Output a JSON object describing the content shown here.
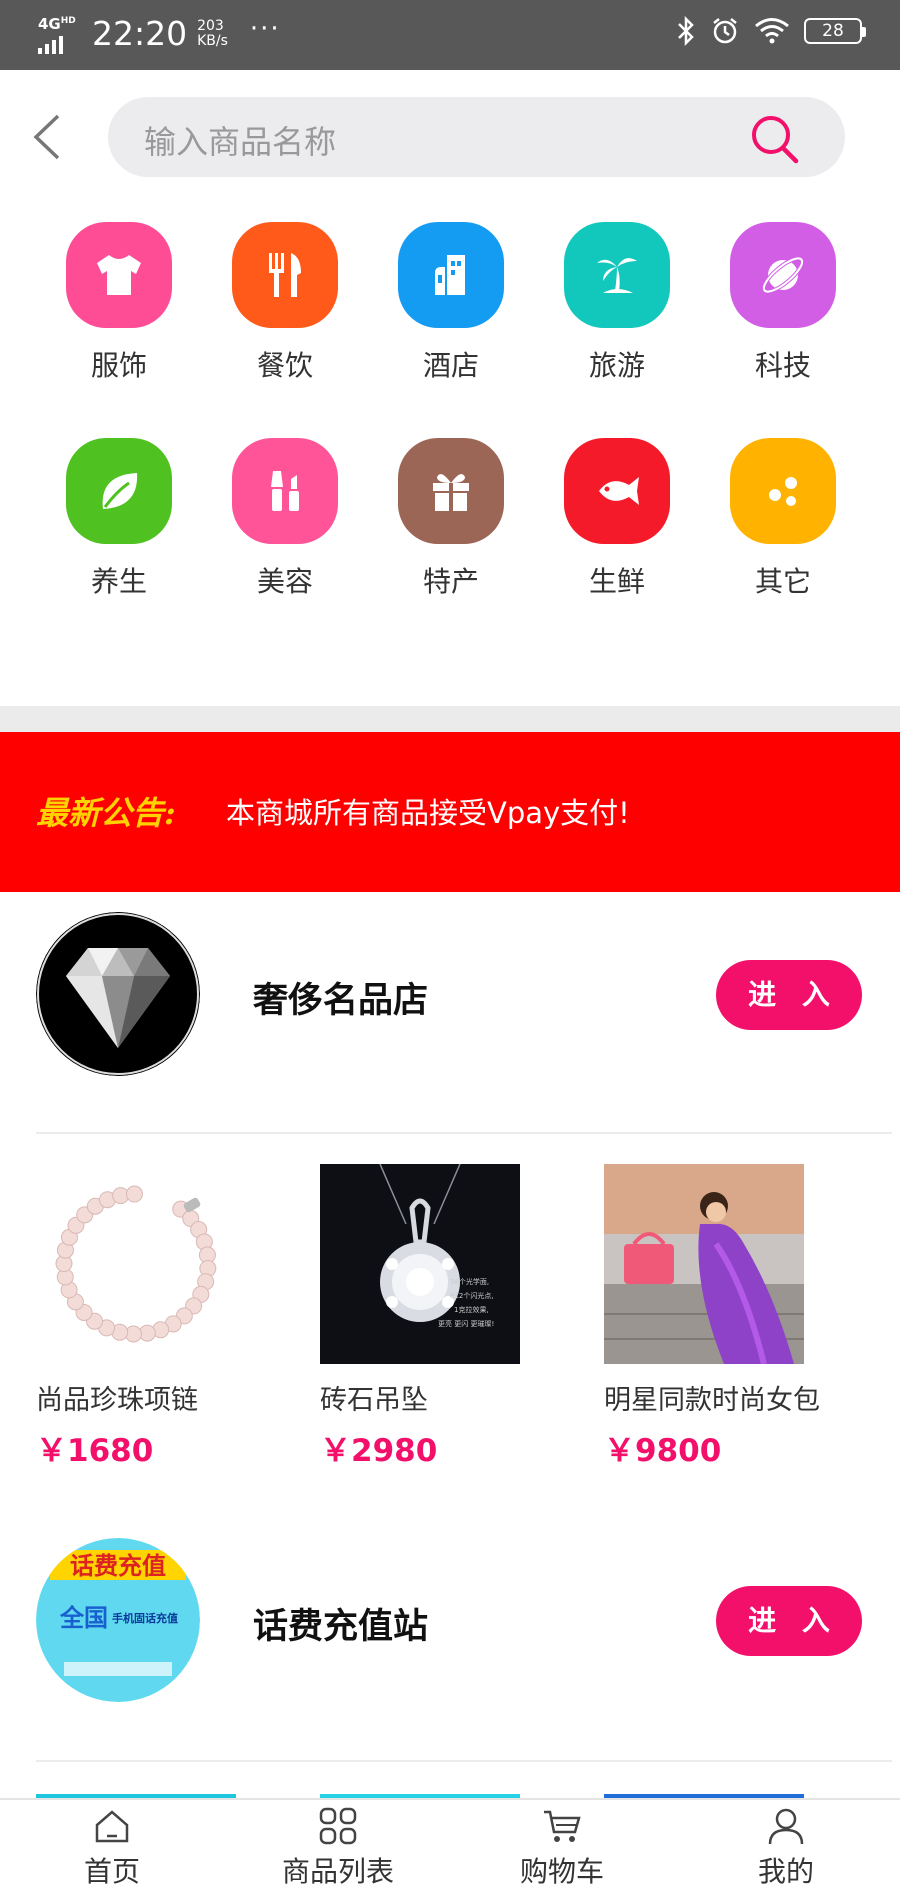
{
  "status_bar": {
    "network": "4G",
    "network_sup": "HD",
    "time": "22:20",
    "speed_value": "203",
    "speed_unit": "KB/s",
    "more": "···",
    "battery": "28",
    "icons": [
      "bluetooth-icon",
      "alarm-icon",
      "wifi-icon",
      "battery-icon"
    ]
  },
  "search": {
    "placeholder": "输入商品名称"
  },
  "categories": [
    {
      "label": "服饰",
      "icon": "shirt-icon",
      "color": "#ff4d95"
    },
    {
      "label": "餐饮",
      "icon": "utensils-icon",
      "color": "#ff5a1a"
    },
    {
      "label": "酒店",
      "icon": "building-icon",
      "color": "#149bf2"
    },
    {
      "label": "旅游",
      "icon": "palm-tree-icon",
      "color": "#12c8bd"
    },
    {
      "label": "科技",
      "icon": "planet-icon",
      "color": "#d25ee6"
    },
    {
      "label": "养生",
      "icon": "leaf-icon",
      "color": "#4fc222"
    },
    {
      "label": "美容",
      "icon": "cosmetics-icon",
      "color": "#ff5497"
    },
    {
      "label": "特产",
      "icon": "gift-icon",
      "color": "#9c6656"
    },
    {
      "label": "生鲜",
      "icon": "fish-icon",
      "color": "#f41a2a"
    },
    {
      "label": "其它",
      "icon": "dots-icon",
      "color": "#ffb300"
    }
  ],
  "notice": {
    "title": "最新公告:",
    "text": "本商城所有商品接受Vpay支付!"
  },
  "stores": [
    {
      "name": "奢侈名品店",
      "enter": "进 入",
      "products": [
        {
          "name": "尚品珍珠项链",
          "price": "￥1680"
        },
        {
          "name": "砖石吊坠",
          "price": "￥2980"
        },
        {
          "name": "明星同款时尚女包",
          "price": "￥9800"
        }
      ],
      "pendant_caption": [
        "58个光学面,",
        "812个闪光点,",
        "1克拉效果,",
        "更亮 更闪 更璀璨!"
      ]
    },
    {
      "name": "话费充值站",
      "enter": "进 入",
      "logo_text": [
        "话费充值",
        "全国",
        "手机固话充值"
      ]
    }
  ],
  "tabbar": [
    {
      "label": "首页",
      "icon": "home-icon"
    },
    {
      "label": "商品列表",
      "icon": "grid-icon"
    },
    {
      "label": "购物车",
      "icon": "cart-icon"
    },
    {
      "label": "我的",
      "icon": "user-icon"
    }
  ],
  "colors": {
    "accent": "#f3106a",
    "notice_bg": "#fe0000",
    "notice_title": "#ffd200"
  }
}
